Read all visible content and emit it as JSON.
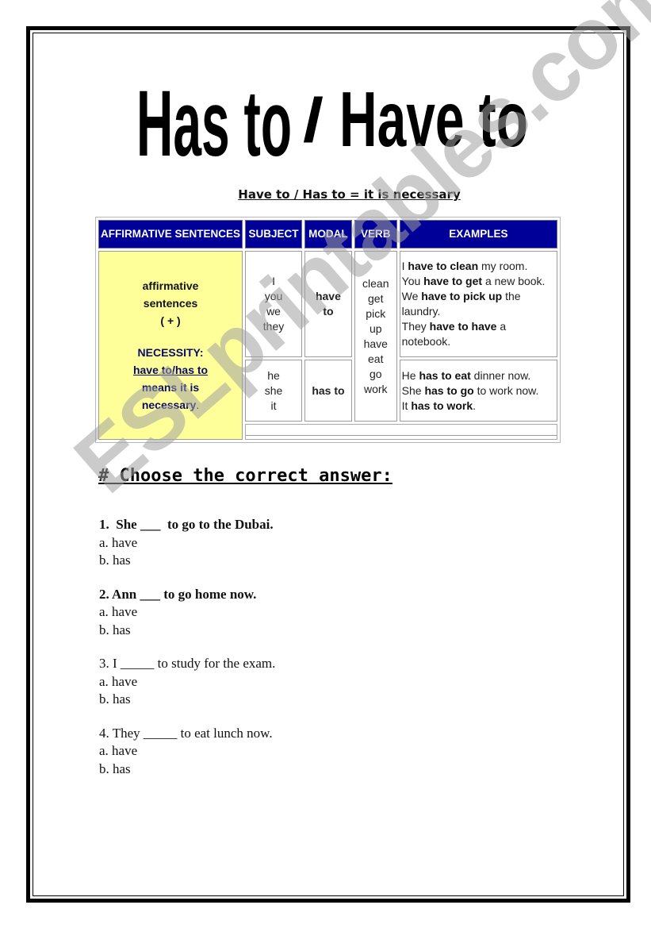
{
  "title": {
    "part1": "Has to",
    "separator": "/",
    "part2": "Have to"
  },
  "subtitle": "Have to / Has to = it is necessary",
  "table": {
    "headers": {
      "affirmative": "AFFIRMATIVE SENTENCES",
      "subject": "SUBJECT",
      "modal": "MODAL",
      "verb": "VERB",
      "examples": "EXAMPLES"
    },
    "affirmative_cell": {
      "line1": "affirmative",
      "line2": "sentences",
      "line3": "( + )",
      "necessity": "NECESSITY:",
      "underlined": "have to/has to",
      "means": "means it is",
      "necessary": "necessary",
      "period": "."
    },
    "rows": [
      {
        "subjects": [
          "I",
          "you",
          "we",
          "they"
        ],
        "modal_1": "have",
        "modal_2": "to",
        "examples": [
          {
            "pre": "I ",
            "bold": "have to clean",
            "post": " my room."
          },
          {
            "pre": "You ",
            "bold": "have to get",
            "post": " a new book."
          },
          {
            "pre": "We ",
            "bold": "have to pick up",
            "post": " the laundry."
          },
          {
            "pre": "They ",
            "bold": "have to have",
            "post": " a notebook."
          }
        ]
      },
      {
        "subjects": [
          "he",
          "she",
          "it"
        ],
        "modal_1": "has to",
        "examples": [
          {
            "pre": "He ",
            "bold": "has to eat",
            "post": " dinner now."
          },
          {
            "pre": "She ",
            "bold": "has to go",
            "post": " to work now."
          },
          {
            "pre": "It ",
            "bold": "has to work",
            "post": "."
          }
        ]
      }
    ],
    "verbs": [
      "clean",
      "get",
      "pick",
      "up",
      "have",
      "eat",
      "go",
      "work"
    ]
  },
  "exercise": {
    "heading": "# Choose the correct answer:",
    "questions": [
      {
        "stem": "1.  She ___  to go to the Dubai.",
        "bold": true,
        "options": [
          "a. have",
          "b. has"
        ]
      },
      {
        "stem": "2. Ann ___ to go home now.",
        "bold": true,
        "options": [
          "a. have",
          "b. has"
        ]
      },
      {
        "stem": "3. I _____ to study for the exam.",
        "bold": false,
        "options": [
          "a. have",
          "b. has"
        ]
      },
      {
        "stem": "4. They _____ to eat lunch now.",
        "bold": false,
        "options": [
          "a. have",
          "b. has"
        ]
      }
    ]
  },
  "watermark": "ESLprintables.com",
  "colors": {
    "header_bg": "#000099",
    "header_text": "#ffffff",
    "affirmative_bg": "#ffff99",
    "necessity_text": "#0a0a6a",
    "watermark": "#a0a0a0"
  }
}
